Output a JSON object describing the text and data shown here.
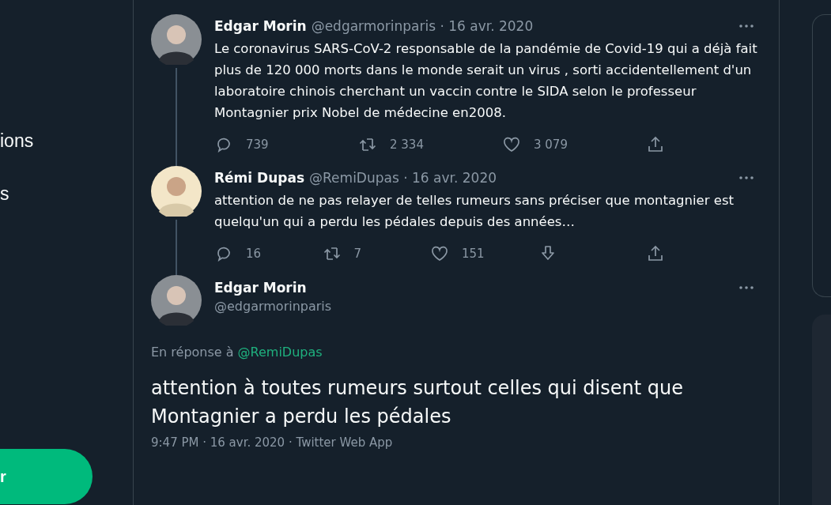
{
  "sidebar": {
    "items": [
      {
        "label": "ions"
      },
      {
        "label": "s"
      }
    ],
    "button": "r"
  },
  "thread": [
    {
      "name": "Edgar Morin",
      "byline": "@edgarmorinparis · 16 avr. 2020",
      "text": "Le coronavirus SARS-CoV-2 responsable de la pandémie de Covid-19 qui a déjà fait plus de 120 000 morts dans le monde serait un virus , sorti accidentellement d'un laboratoire chinois cherchant un vaccin contre le SIDA selon le professeur Montagnier prix Nobel de médecine en2008.",
      "actions": [
        {
          "kind": "reply",
          "count": "739"
        },
        {
          "kind": "retweet",
          "count": "2 334"
        },
        {
          "kind": "like",
          "count": "3 079"
        },
        {
          "kind": "share"
        }
      ]
    },
    {
      "name": "Rémi Dupas",
      "byline": "@RemiDupas · 16 avr. 2020",
      "text": "attention de ne pas relayer de telles rumeurs sans préciser que montagnier est quelqu'un qui a perdu les pédales depuis des années…",
      "actions": [
        {
          "kind": "reply",
          "count": "16"
        },
        {
          "kind": "retweet",
          "count": "7"
        },
        {
          "kind": "like",
          "count": "151"
        },
        {
          "kind": "download"
        },
        {
          "kind": "share"
        }
      ]
    }
  ],
  "focus": {
    "name": "Edgar Morin",
    "handle": "@edgarmorinparis",
    "reply_prefix": "En réponse à",
    "reply_mention": "@RemiDupas",
    "text": "attention à toutes rumeurs surtout celles qui disent que Montagnier a perdu les pédales",
    "meta": "9:47 PM · 16 avr. 2020 · Twitter Web App"
  }
}
